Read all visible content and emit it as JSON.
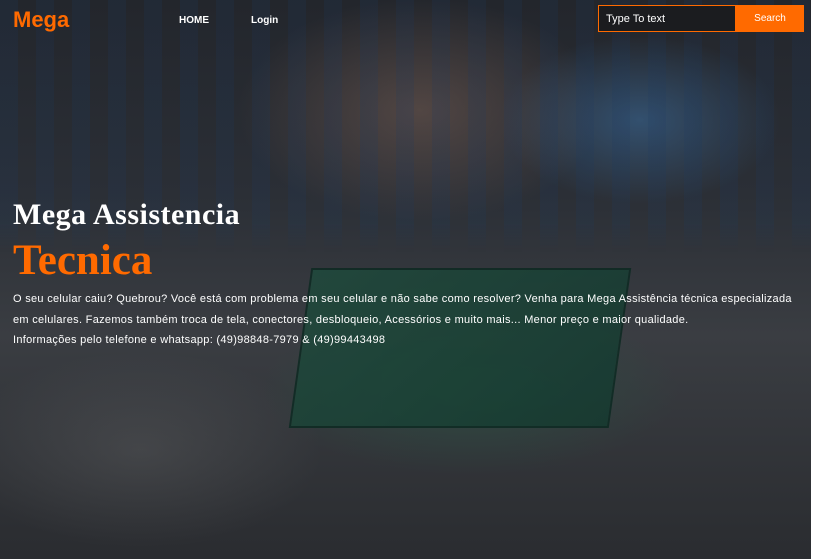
{
  "nav": {
    "logo": "Mega",
    "links": [
      "HOME",
      "Login"
    ]
  },
  "search": {
    "placeholder": "Type To text",
    "button_label": "Search"
  },
  "hero": {
    "title": "Mega Assistencia",
    "subtitle": "Tecnica",
    "description": "O seu celular caiu? Quebrou? Você está com problema em seu celular e não sabe como resolver? Venha para Mega Assistência técnica especializada em celulares. Fazemos também troca de tela, conectores, desbloqueio, Acessórios e muito mais... Menor preço e maior qualidade.",
    "contact": "Informações pelo telefone e whatsapp: (49)98848-7979 & (49)99443498"
  },
  "colors": {
    "accent": "#ff6a00",
    "text": "#ffffff",
    "background": "#1a1d22"
  }
}
